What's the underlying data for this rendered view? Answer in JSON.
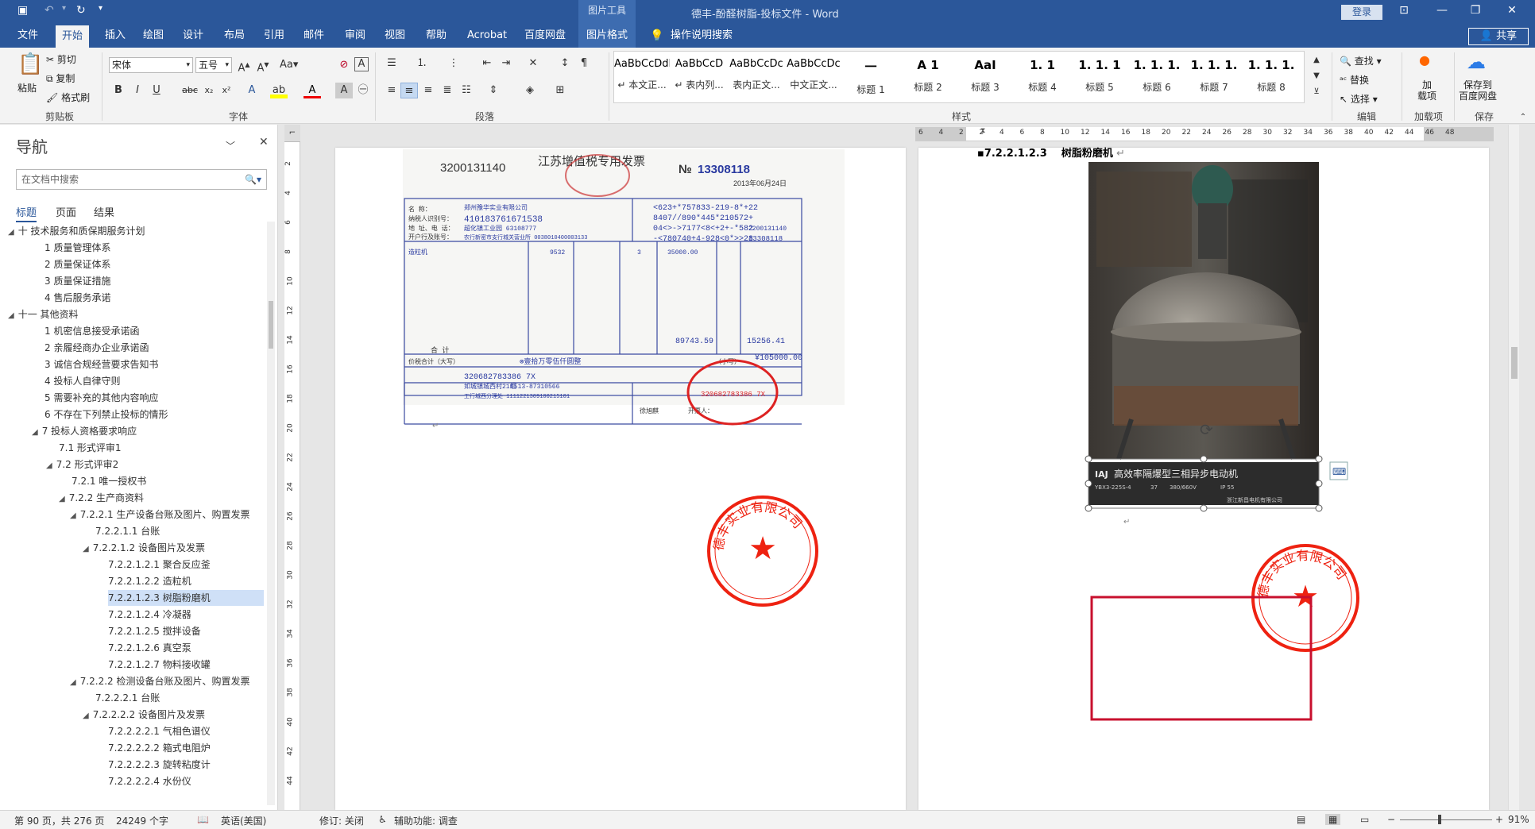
{
  "titlebar": {
    "picture_tools": "图片工具",
    "title": "德丰-酚醛树脂-投标文件  -  Word",
    "login": "登录"
  },
  "tabs": [
    "文件",
    "开始",
    "插入",
    "绘图",
    "设计",
    "布局",
    "引用",
    "邮件",
    "审阅",
    "视图",
    "帮助",
    "Acrobat",
    "百度网盘",
    "图片格式"
  ],
  "active_tab": "开始",
  "tell_me": "操作说明搜索",
  "share": "共享",
  "clipboard": {
    "paste": "粘贴",
    "cut": "剪切",
    "copy": "复制",
    "format_painter": "格式刷",
    "label": "剪贴板"
  },
  "font": {
    "name": "宋体",
    "size": "五号",
    "label": "字体"
  },
  "paragraph_label": "段落",
  "styles": {
    "label": "样式",
    "items": [
      {
        "preview": "AaBbCcDdI",
        "name": "↵ 本文正..."
      },
      {
        "preview": "AaBbCcD",
        "name": "↵ 表内列..."
      },
      {
        "preview": "AaBbCcDc",
        "name": "表内正文..."
      },
      {
        "preview": "AaBbCcDc",
        "name": "中文正文..."
      },
      {
        "preview": "一",
        "name": "标题 1"
      },
      {
        "preview": "A 1",
        "name": "标题 2"
      },
      {
        "preview": "AaI",
        "name": "标题 3"
      },
      {
        "preview": "1. 1",
        "name": "标题 4"
      },
      {
        "preview": "1. 1. 1",
        "name": "标题 5"
      },
      {
        "preview": "1. 1. 1.",
        "name": "标题 6"
      },
      {
        "preview": "1. 1. 1.",
        "name": "标题 7"
      },
      {
        "preview": "1. 1. 1.",
        "name": "标题 8"
      }
    ]
  },
  "editing": {
    "find": "查找",
    "replace": "替换",
    "select": "选择",
    "label": "编辑"
  },
  "addins": {
    "load": "加\n载项",
    "label": "加载项"
  },
  "baidu": {
    "save": "保存到\n百度网盘",
    "label": "保存"
  },
  "nav": {
    "title": "导航",
    "search_placeholder": "在文档中搜索",
    "tabs": [
      "标题",
      "页面",
      "结果"
    ],
    "items": [
      {
        "text": "十  技术服务和质保期服务计划",
        "level": 0,
        "tw": "▲"
      },
      {
        "text": "1 质量管理体系",
        "level": 1
      },
      {
        "text": "2 质量保证体系",
        "level": 1
      },
      {
        "text": "3 质量保证措施",
        "level": 1
      },
      {
        "text": "4 售后服务承诺",
        "level": 1
      },
      {
        "text": "十一  其他资料",
        "level": 0,
        "tw": "▲"
      },
      {
        "text": "1 机密信息接受承诺函",
        "level": 1
      },
      {
        "text": "2 亲履经商办企业承诺函",
        "level": 1
      },
      {
        "text": "3 诚信合规经营要求告知书",
        "level": 1
      },
      {
        "text": "4 投标人自律守则",
        "level": 1
      },
      {
        "text": "5 需要补充的其他内容响应",
        "level": 1
      },
      {
        "text": "6 不存在下列禁止投标的情形",
        "level": 1
      },
      {
        "text": "7 投标人资格要求响应",
        "level": 1,
        "tw": "▲"
      },
      {
        "text": "7.1 形式评审1",
        "level": 2
      },
      {
        "text": "7.2 形式评审2",
        "level": 2,
        "tw": "▲"
      },
      {
        "text": "7.2.1 唯一授权书",
        "level": 3
      },
      {
        "text": "7.2.2 生产商资料",
        "level": 3,
        "tw": "▲"
      },
      {
        "text": "7.2.2.1 生产设备台账及图片、购置发票",
        "level": 4,
        "tw": "▲"
      },
      {
        "text": "7.2.2.1.1 台账",
        "level": 5
      },
      {
        "text": "7.2.2.1.2 设备图片及发票",
        "level": 5,
        "tw": "▲"
      },
      {
        "text": "7.2.2.1.2.1 聚合反应釜",
        "level": 6
      },
      {
        "text": "7.2.2.1.2.2 造粒机",
        "level": 6
      },
      {
        "text": "7.2.2.1.2.3 树脂粉磨机",
        "level": 6,
        "selected": true
      },
      {
        "text": "7.2.2.1.2.4 冷凝器",
        "level": 6
      },
      {
        "text": "7.2.2.1.2.5 搅拌设备",
        "level": 6
      },
      {
        "text": "7.2.2.1.2.6 真空泵",
        "level": 6
      },
      {
        "text": "7.2.2.1.2.7 物料接收罐",
        "level": 6
      },
      {
        "text": "7.2.2.2 检测设备台账及图片、购置发票",
        "level": 4,
        "tw": "▲"
      },
      {
        "text": "7.2.2.2.1 台账",
        "level": 5
      },
      {
        "text": "7.2.2.2.2 设备图片及发票",
        "level": 5,
        "tw": "▲"
      },
      {
        "text": "7.2.2.2.2.1 气相色谱仪",
        "level": 6
      },
      {
        "text": "7.2.2.2.2.2 箱式电阻炉",
        "level": 6
      },
      {
        "text": "7.2.2.2.2.3 旋转粘度计",
        "level": 6
      },
      {
        "text": "7.2.2.2.2.4 水份仪",
        "level": 6
      }
    ]
  },
  "invoice": {
    "code": "3200131140",
    "title": "江苏增值税专用发票",
    "no_prefix": "№",
    "number": "13308118",
    "date": "2013年06月24日",
    "buyer_name": "郑州豫华实业有限公司",
    "buyer_tax": "410183761671538",
    "buyer_addr": "超化镇工业园 63108777",
    "buyer_bank": "农行新密市支行城关营业所 0038010400003133",
    "cipher1": "<623+*757833-219-8*+22",
    "cipher2": "8407//890*445*210572+",
    "cipher3": "04<>->7177<8<+2+-*582",
    "cipher4": "-<780740+4-928<0*>>28",
    "right_code1": "2200131140",
    "right_code2": "13308118",
    "item": "造粒机",
    "model": "9532",
    "qty": "3",
    "price": "35000.00",
    "amount": "89743.59",
    "tax": "15256.41",
    "total_label": "合    计",
    "sum_label": "价税合计（大写）",
    "sum_words": "⊗壹拾万零伍仟圆整",
    "sum_small": "¥105000.00",
    "small_label": "（小写）",
    "seller_tax": "320682783386 7X",
    "seller_phone": "0513-87310566",
    "seller_addr": "如城镇城西村21组",
    "seller_bank": "工行城西分理处 1111221309100215101",
    "note": "徐旭麒",
    "payee": "开票人：",
    "stamp_text": "320682783386 7X",
    "column_labels": [
      "名        称：",
      "纳税人识别号：",
      "地  址、电  话：",
      "开户行及账号："
    ]
  },
  "page2": {
    "heading_number": "7.2.2.1.2.3",
    "heading_text": "树脂粉磨机",
    "plate_brand": "IAJ",
    "plate_text": "高效率隔爆型三相异步电动机",
    "plate_model": "YBX3-225S-4",
    "plate_kw": "37",
    "plate_v": "380/660V",
    "plate_ip": "IP 55",
    "plate_make": "浙江新昌电机有限公司"
  },
  "seal_text": "德丰实业有限公司",
  "status": {
    "page": "第 90 页，共 276 页",
    "words": "24249 个字",
    "lang": "英语(美国)",
    "revision": "修订: 关闭",
    "accessibility": "辅助功能: 调查",
    "zoom": "91%"
  },
  "vruler_labels": [
    "2",
    "4",
    "6",
    "8",
    "10",
    "12",
    "14",
    "16",
    "18",
    "20",
    "22",
    "24",
    "26",
    "28",
    "30",
    "32",
    "34",
    "36",
    "38",
    "40",
    "42",
    "44"
  ],
  "hruler_labels": [
    "6",
    "4",
    "2",
    "2",
    "4",
    "6",
    "8",
    "10",
    "12",
    "14",
    "16",
    "18",
    "20",
    "22",
    "24",
    "26",
    "28",
    "30",
    "32",
    "34",
    "36",
    "38",
    "40",
    "42",
    "44",
    "46",
    "48"
  ]
}
